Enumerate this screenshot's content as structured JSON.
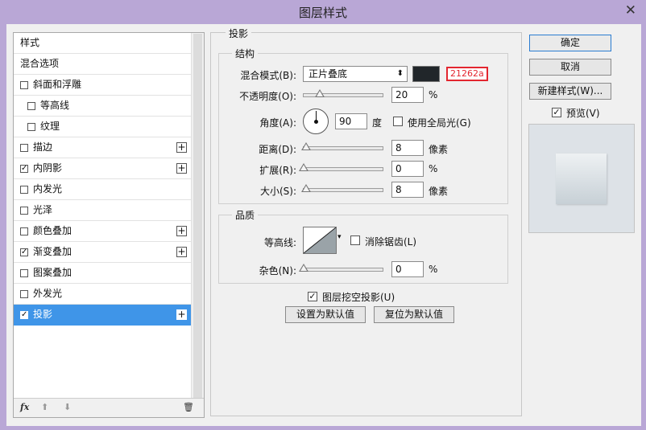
{
  "window": {
    "title": "图层样式",
    "close_glyph": "✕"
  },
  "style_list": {
    "items": [
      {
        "label": "样式",
        "checkbox": false,
        "checked": false,
        "plus": false,
        "indent": 0,
        "selected": false
      },
      {
        "label": "混合选项",
        "checkbox": false,
        "checked": false,
        "plus": false,
        "indent": 0,
        "selected": false
      },
      {
        "label": "斜面和浮雕",
        "checkbox": true,
        "checked": false,
        "plus": false,
        "indent": 0,
        "selected": false
      },
      {
        "label": "等高线",
        "checkbox": true,
        "checked": false,
        "plus": false,
        "indent": 1,
        "selected": false
      },
      {
        "label": "纹理",
        "checkbox": true,
        "checked": false,
        "plus": false,
        "indent": 1,
        "selected": false
      },
      {
        "label": "描边",
        "checkbox": true,
        "checked": false,
        "plus": true,
        "indent": 0,
        "selected": false
      },
      {
        "label": "内阴影",
        "checkbox": true,
        "checked": true,
        "plus": true,
        "indent": 0,
        "selected": false
      },
      {
        "label": "内发光",
        "checkbox": true,
        "checked": false,
        "plus": false,
        "indent": 0,
        "selected": false
      },
      {
        "label": "光泽",
        "checkbox": true,
        "checked": false,
        "plus": false,
        "indent": 0,
        "selected": false
      },
      {
        "label": "颜色叠加",
        "checkbox": true,
        "checked": false,
        "plus": true,
        "indent": 0,
        "selected": false
      },
      {
        "label": "渐变叠加",
        "checkbox": true,
        "checked": true,
        "plus": true,
        "indent": 0,
        "selected": false
      },
      {
        "label": "图案叠加",
        "checkbox": true,
        "checked": false,
        "plus": false,
        "indent": 0,
        "selected": false
      },
      {
        "label": "外发光",
        "checkbox": true,
        "checked": false,
        "plus": false,
        "indent": 0,
        "selected": false
      },
      {
        "label": "投影",
        "checkbox": true,
        "checked": true,
        "plus": true,
        "indent": 0,
        "selected": true
      }
    ],
    "footer": {
      "fx": "fx",
      "up": "⬆",
      "down": "⬇",
      "trash": "🗑"
    }
  },
  "drop_shadow": {
    "section_title": "投影",
    "structure": {
      "title": "结构",
      "blend_mode_label": "混合模式(B):",
      "blend_mode_value": "正片叠底",
      "color_hex": "21262a",
      "opacity_label": "不透明度(O):",
      "opacity_value": "20",
      "opacity_unit": "%",
      "angle_label": "角度(A):",
      "angle_value": "90",
      "angle_unit": "度",
      "global_light_label": "使用全局光(G)",
      "global_light_checked": false,
      "distance_label": "距离(D):",
      "distance_value": "8",
      "distance_unit": "像素",
      "spread_label": "扩展(R):",
      "spread_value": "0",
      "spread_unit": "%",
      "size_label": "大小(S):",
      "size_value": "8",
      "size_unit": "像素"
    },
    "quality": {
      "title": "品质",
      "contour_label": "等高线:",
      "anti_alias_label": "消除锯齿(L)",
      "anti_alias_checked": false,
      "noise_label": "杂色(N):",
      "noise_value": "0",
      "noise_unit": "%"
    },
    "knockout_label": "图层挖空投影(U)",
    "knockout_checked": true,
    "make_default_label": "设置为默认值",
    "reset_default_label": "复位为默认值"
  },
  "buttons": {
    "ok": "确定",
    "cancel": "取消",
    "new_style": "新建样式(W)...",
    "preview_label": "预览(V)",
    "preview_checked": true
  },
  "colors": {
    "shadow_color": "#21262a",
    "selection": "#3f95e8",
    "title_bar": "#b9a7d6",
    "hex_highlight": "#e3262f"
  }
}
